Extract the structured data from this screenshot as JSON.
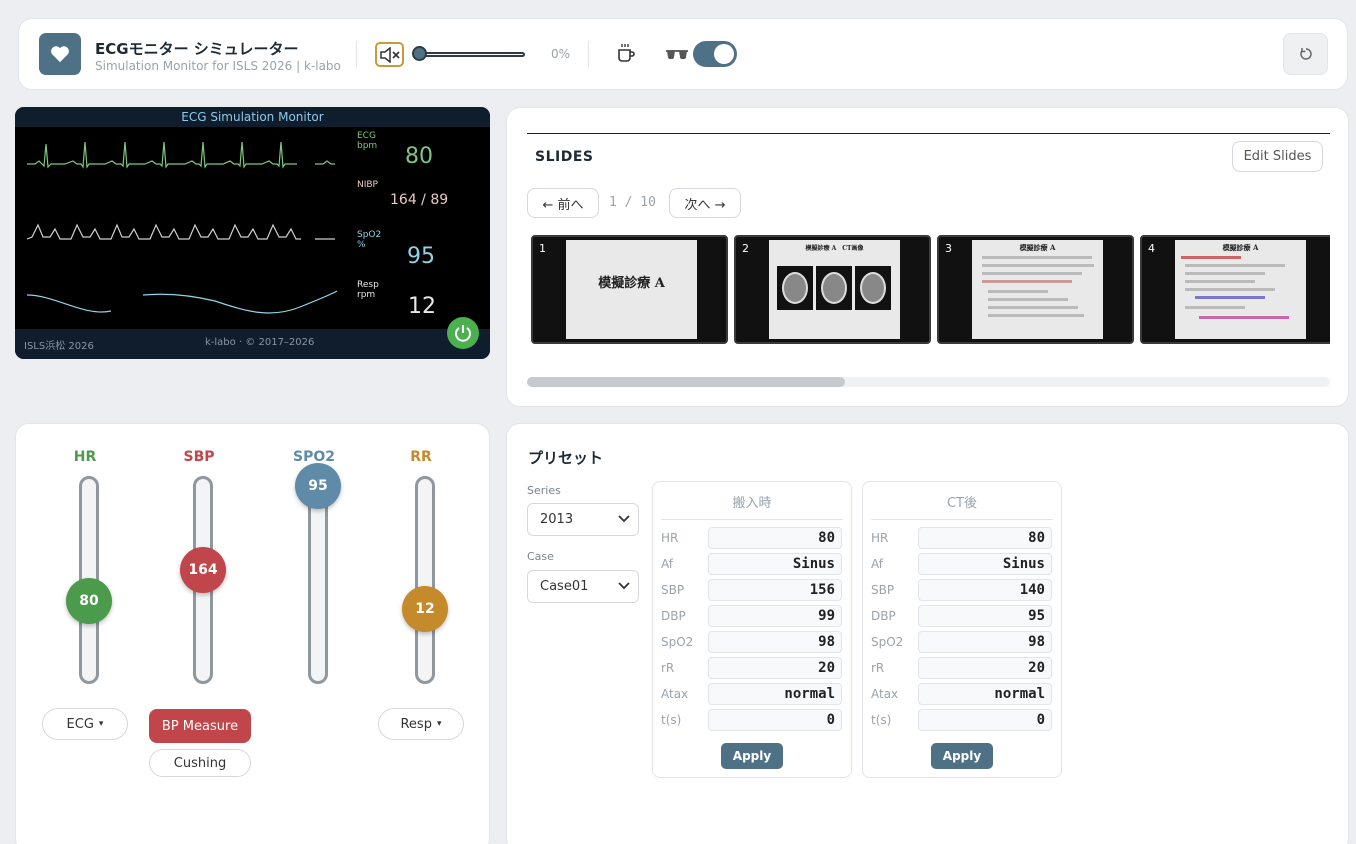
{
  "header": {
    "title": "ECGモニター シミュレーター",
    "subtitle": "Simulation Monitor for ISLS 2026 | k-labo",
    "volume_percent": "0%",
    "volume_level": 0,
    "night_mode_on": true,
    "icons": [
      "heart-icon",
      "mute-speaker-icon",
      "coffee-cup-icon",
      "glasses-icon",
      "reset-icon"
    ]
  },
  "monitor": {
    "title": "ECG Simulation Monitor",
    "ecg_label": "ECG",
    "ecg_unit": "bpm",
    "ecg_value": "80",
    "nibp_label": "NIBP",
    "nibp_value": "164 / 89",
    "spo2_label": "SpO2",
    "spo2_unit": "%",
    "spo2_value": "95",
    "resp_label": "Resp",
    "resp_unit": "rpm",
    "resp_value": "12",
    "footer_left": "ISLS浜松 2026",
    "footer_center": "k-labo · © 2017–2026",
    "colors": {
      "ecg": "#7ec87e",
      "nibp": "#e8c8c8",
      "spo2": "#8ed4ea",
      "resp": "#e8e8e8"
    }
  },
  "slides": {
    "title": "SLIDES",
    "edit_label": "Edit Slides",
    "prev_label": "← 前へ",
    "next_label": "次へ →",
    "page_indicator": "1 / 10",
    "items": [
      {
        "num": "1",
        "heading": "模擬診療 A"
      },
      {
        "num": "2",
        "heading": "模擬診療 A　CT画像"
      },
      {
        "num": "3",
        "heading": "模擬診療 A"
      },
      {
        "num": "4",
        "heading": "模擬診療 A"
      }
    ]
  },
  "sliders": {
    "hr": {
      "label": "HR",
      "value": "80",
      "color": "#4c9a4c",
      "level": 0.4
    },
    "sbp": {
      "label": "SBP",
      "value": "164",
      "color": "#c0464b",
      "level": 0.55
    },
    "spo2": {
      "label": "SPO2",
      "value": "95",
      "color": "#5f8aa8",
      "level": 0.95
    },
    "rr": {
      "label": "RR",
      "value": "12",
      "color": "#c58a2b",
      "level": 0.36
    },
    "ecg_button": "ECG",
    "bp_button": "BP Measure",
    "cushing_button": "Cushing",
    "resp_button": "Resp",
    "caret": "▾"
  },
  "presets": {
    "title": "プリセット",
    "series_label": "Series",
    "series_value": "2013",
    "case_label": "Case",
    "case_value": "Case01",
    "row_labels": [
      "HR",
      "Af",
      "SBP",
      "DBP",
      "SpO2",
      "rR",
      "Atax",
      "t(s)"
    ],
    "columns": [
      {
        "name": "搬入時",
        "values": [
          "80",
          "Sinus",
          "156",
          "99",
          "98",
          "20",
          "normal",
          "0"
        ],
        "apply": "Apply"
      },
      {
        "name": "CT後",
        "values": [
          "80",
          "Sinus",
          "140",
          "95",
          "98",
          "20",
          "normal",
          "0"
        ],
        "apply": "Apply"
      }
    ]
  }
}
